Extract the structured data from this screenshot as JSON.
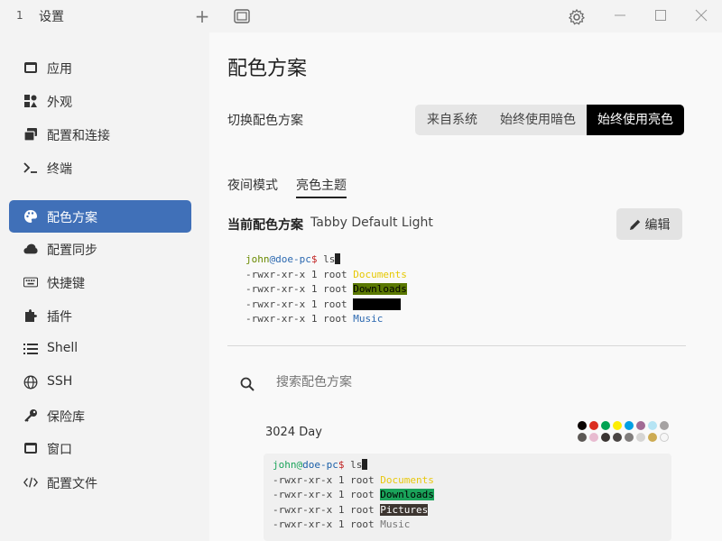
{
  "titlebar": {
    "tab_number": "1",
    "tab_title": "设置",
    "add_tab": "+"
  },
  "sidebar": {
    "items": [
      {
        "label": "应用",
        "icon": "window-icon"
      },
      {
        "label": "外观",
        "icon": "shapes-icon"
      },
      {
        "label": "配置和连接",
        "icon": "windows-stack-icon"
      },
      {
        "label": "终端",
        "icon": "terminal-icon"
      },
      {
        "label": "配色方案",
        "icon": "palette-icon",
        "active": true
      },
      {
        "label": "配置同步",
        "icon": "cloud-icon"
      },
      {
        "label": "快捷键",
        "icon": "keyboard-icon"
      },
      {
        "label": "插件",
        "icon": "puzzle-icon"
      },
      {
        "label": "Shell",
        "icon": "list-icon"
      },
      {
        "label": "SSH",
        "icon": "globe-icon"
      },
      {
        "label": "保险库",
        "icon": "key-icon"
      },
      {
        "label": "窗口",
        "icon": "window-icon"
      },
      {
        "label": "配置文件",
        "icon": "code-icon"
      }
    ]
  },
  "main": {
    "title": "配色方案",
    "switch_label": "切换配色方案",
    "modes": [
      "来自系统",
      "始终使用暗色",
      "始终使用亮色"
    ],
    "active_mode": "始终使用亮色",
    "subtabs": [
      "夜间模式",
      "亮色主题"
    ],
    "active_subtab": "亮色主题",
    "current_label": "当前配色方案",
    "current_value": "Tabby Default Light",
    "edit_label": "编辑",
    "preview": {
      "user": "john",
      "at": "@",
      "host": "doe-pc",
      "prompt": "$",
      "command": " ls",
      "perm": "-rwxr-xr-x",
      "mid": " 1 root ",
      "files": [
        "Documents",
        "Downloads",
        "Pictures",
        "Music"
      ]
    },
    "search_placeholder": "搜索配色方案",
    "scheme": {
      "name": "3024 Day",
      "colors_row1": [
        "#090300",
        "#db2d20",
        "#01a252",
        "#fded02",
        "#01a0e4",
        "#a16a94",
        "#b5e4f4",
        "#a5a2a2"
      ],
      "colors_row2": [
        "#5c5855",
        "#e8bbd0",
        "#3a3432",
        "#4a4543",
        "#807d7c",
        "#d6d5d4",
        "#cdab53",
        "#f7f7f7"
      ]
    }
  },
  "colors": {
    "accent": "#4070b8",
    "active_mode_bg": "#000000"
  }
}
